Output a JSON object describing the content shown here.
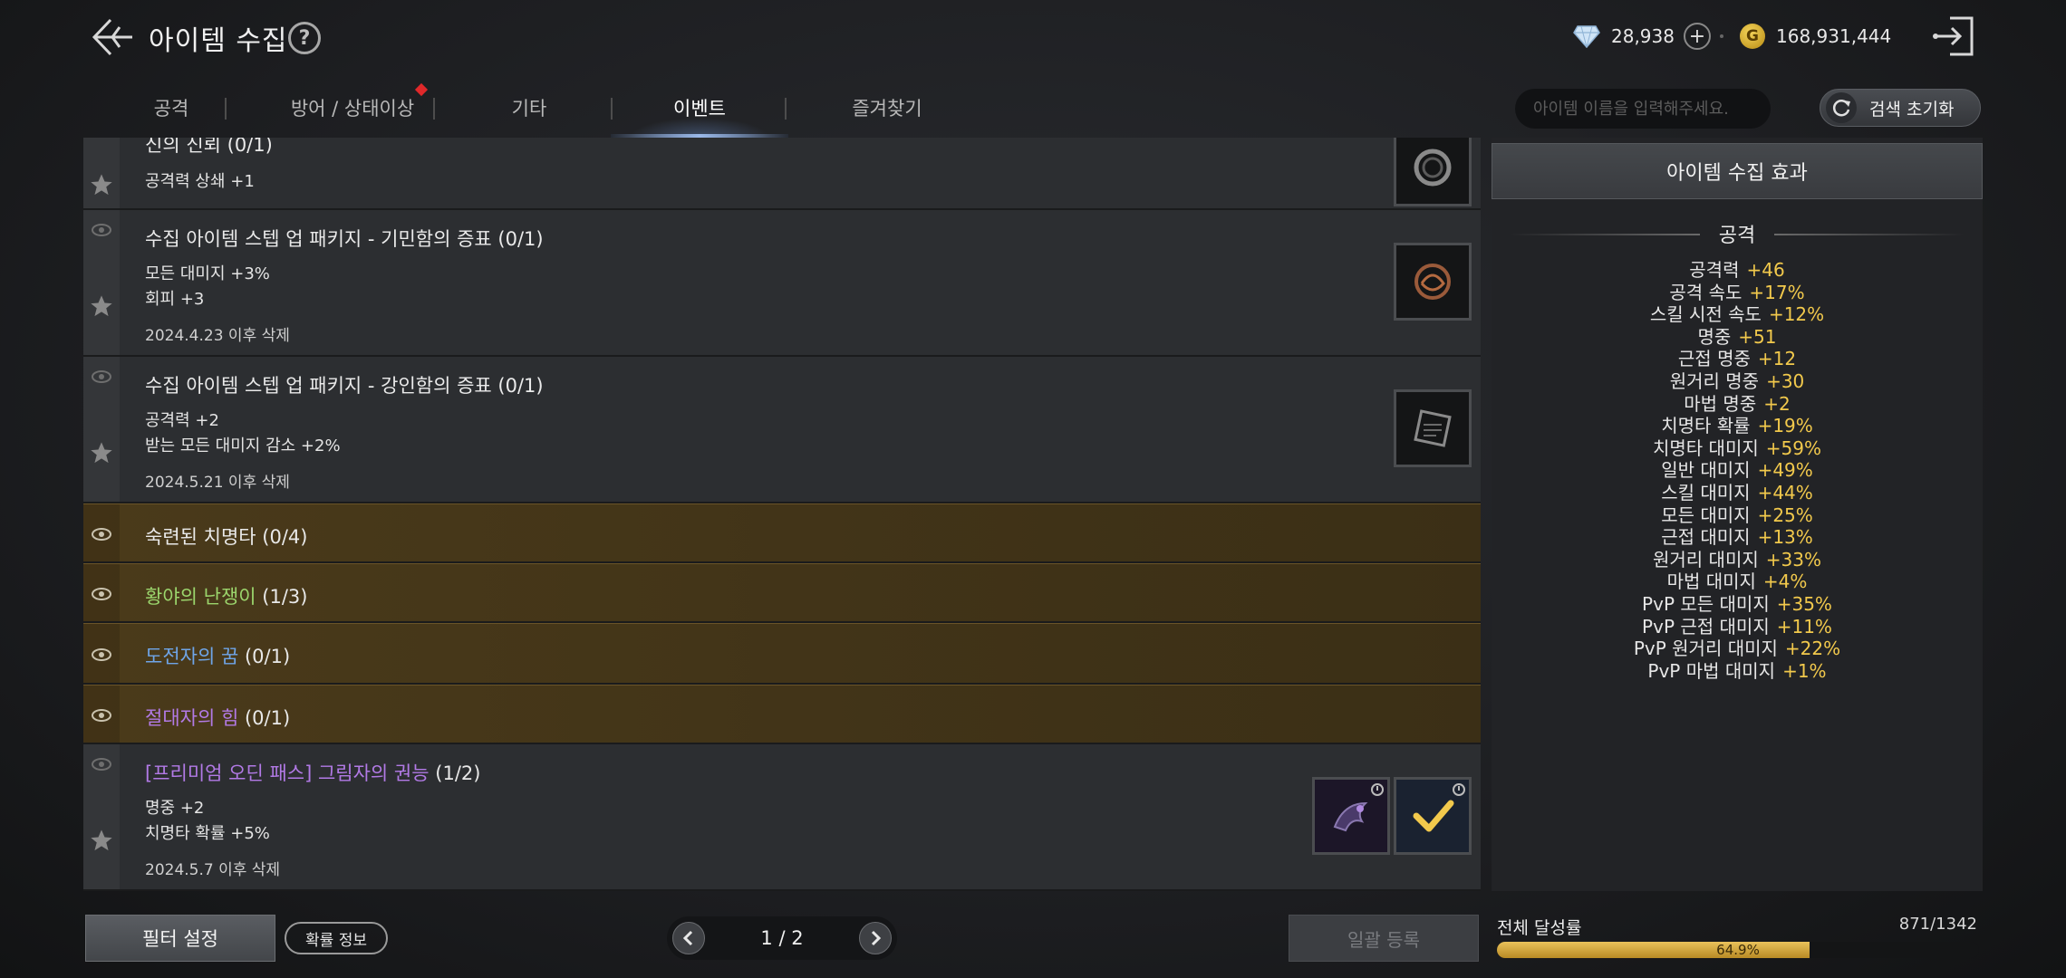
{
  "header": {
    "title": "아이템 수집",
    "help": "?",
    "diamonds": "28,938",
    "gold": "168,931,444",
    "gold_symbol": "G",
    "plus": "+"
  },
  "tabs": [
    {
      "label": "공격"
    },
    {
      "label": "방어 / 상태이상"
    },
    {
      "label": "기타"
    },
    {
      "label": "이벤트"
    },
    {
      "label": "즐겨찾기"
    }
  ],
  "search": {
    "placeholder": "아이템 이름을 입력해주세요.",
    "reset_label": "검색 초기화"
  },
  "list": {
    "rows": [
      {
        "title": "신의 신뢰 (0/1)",
        "lines": [
          "공격력 상쇄 +1"
        ]
      },
      {
        "title": "수집 아이템 스텝 업 패키지 - 기민함의 증표 (0/1)",
        "lines": [
          "모든 대미지 +3%",
          "회피 +3"
        ],
        "date": "2024.4.23 이후 삭제"
      },
      {
        "title": "수집 아이템 스텝 업 패키지 - 강인함의 증표 (0/1)",
        "lines": [
          "공격력 +2",
          "받는 모든 대미지 감소 +2%"
        ],
        "date": "2024.5.21 이후 삭제"
      },
      {
        "name": "숙련된 치명타",
        "count": "(0/4)"
      },
      {
        "name": "황야의 난쟁이",
        "count": "(1/3)"
      },
      {
        "name": "도전자의 꿈",
        "count": "(0/1)"
      },
      {
        "name": "절대자의 힘",
        "count": "(0/1)"
      },
      {
        "name": "[프리미엄 오딘 패스] 그림자의 권능",
        "count": "(1/2)",
        "lines": [
          "명중 +2",
          "치명타 확률 +5%"
        ],
        "date": "2024.5.7 이후 삭제"
      }
    ]
  },
  "effects": {
    "header": "아이템 수집 효과",
    "section": "공격",
    "stats": [
      {
        "name": "공격력",
        "value": "+46"
      },
      {
        "name": "공격 속도",
        "value": "+17%"
      },
      {
        "name": "스킬 시전 속도",
        "value": "+12%"
      },
      {
        "name": "명중",
        "value": "+51"
      },
      {
        "name": "근접 명중",
        "value": "+12"
      },
      {
        "name": "원거리 명중",
        "value": "+30"
      },
      {
        "name": "마법 명중",
        "value": "+2"
      },
      {
        "name": "치명타 확률",
        "value": "+19%"
      },
      {
        "name": "치명타 대미지",
        "value": "+59%"
      },
      {
        "name": "일반 대미지",
        "value": "+49%"
      },
      {
        "name": "스킬 대미지",
        "value": "+44%"
      },
      {
        "name": "모든 대미지",
        "value": "+25%"
      },
      {
        "name": "근접 대미지",
        "value": "+13%"
      },
      {
        "name": "원거리 대미지",
        "value": "+33%"
      },
      {
        "name": "마법 대미지",
        "value": "+4%"
      },
      {
        "name": "PvP 모든 대미지",
        "value": "+35%"
      },
      {
        "name": "PvP 근접 대미지",
        "value": "+11%"
      },
      {
        "name": "PvP 원거리 대미지",
        "value": "+22%"
      },
      {
        "name": "PvP 마법 대미지",
        "value": "+1%"
      }
    ]
  },
  "footer": {
    "filter_label": "필터 설정",
    "prob_label": "확률 정보",
    "page": "1 / 2",
    "bulk_label": "일괄 등록",
    "achievement_label": "전체 달성률",
    "achievement_count": "871/1342",
    "achievement_pct": "64.9%",
    "achievement_fraction": 0.649
  },
  "colors": {
    "accent_gold": "#f2c94c",
    "event_row": "#3f3217",
    "progress_fill": "#d4a73a"
  }
}
